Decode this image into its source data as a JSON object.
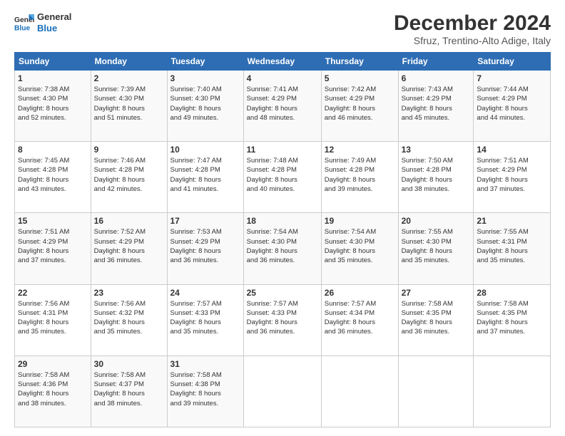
{
  "logo": {
    "line1": "General",
    "line2": "Blue"
  },
  "title": "December 2024",
  "subtitle": "Sfruz, Trentino-Alto Adige, Italy",
  "days_of_week": [
    "Sunday",
    "Monday",
    "Tuesday",
    "Wednesday",
    "Thursday",
    "Friday",
    "Saturday"
  ],
  "weeks": [
    [
      {
        "day": "1",
        "info": "Sunrise: 7:38 AM\nSunset: 4:30 PM\nDaylight: 8 hours\nand 52 minutes."
      },
      {
        "day": "2",
        "info": "Sunrise: 7:39 AM\nSunset: 4:30 PM\nDaylight: 8 hours\nand 51 minutes."
      },
      {
        "day": "3",
        "info": "Sunrise: 7:40 AM\nSunset: 4:30 PM\nDaylight: 8 hours\nand 49 minutes."
      },
      {
        "day": "4",
        "info": "Sunrise: 7:41 AM\nSunset: 4:29 PM\nDaylight: 8 hours\nand 48 minutes."
      },
      {
        "day": "5",
        "info": "Sunrise: 7:42 AM\nSunset: 4:29 PM\nDaylight: 8 hours\nand 46 minutes."
      },
      {
        "day": "6",
        "info": "Sunrise: 7:43 AM\nSunset: 4:29 PM\nDaylight: 8 hours\nand 45 minutes."
      },
      {
        "day": "7",
        "info": "Sunrise: 7:44 AM\nSunset: 4:29 PM\nDaylight: 8 hours\nand 44 minutes."
      }
    ],
    [
      {
        "day": "8",
        "info": "Sunrise: 7:45 AM\nSunset: 4:28 PM\nDaylight: 8 hours\nand 43 minutes."
      },
      {
        "day": "9",
        "info": "Sunrise: 7:46 AM\nSunset: 4:28 PM\nDaylight: 8 hours\nand 42 minutes."
      },
      {
        "day": "10",
        "info": "Sunrise: 7:47 AM\nSunset: 4:28 PM\nDaylight: 8 hours\nand 41 minutes."
      },
      {
        "day": "11",
        "info": "Sunrise: 7:48 AM\nSunset: 4:28 PM\nDaylight: 8 hours\nand 40 minutes."
      },
      {
        "day": "12",
        "info": "Sunrise: 7:49 AM\nSunset: 4:28 PM\nDaylight: 8 hours\nand 39 minutes."
      },
      {
        "day": "13",
        "info": "Sunrise: 7:50 AM\nSunset: 4:28 PM\nDaylight: 8 hours\nand 38 minutes."
      },
      {
        "day": "14",
        "info": "Sunrise: 7:51 AM\nSunset: 4:29 PM\nDaylight: 8 hours\nand 37 minutes."
      }
    ],
    [
      {
        "day": "15",
        "info": "Sunrise: 7:51 AM\nSunset: 4:29 PM\nDaylight: 8 hours\nand 37 minutes."
      },
      {
        "day": "16",
        "info": "Sunrise: 7:52 AM\nSunset: 4:29 PM\nDaylight: 8 hours\nand 36 minutes."
      },
      {
        "day": "17",
        "info": "Sunrise: 7:53 AM\nSunset: 4:29 PM\nDaylight: 8 hours\nand 36 minutes."
      },
      {
        "day": "18",
        "info": "Sunrise: 7:54 AM\nSunset: 4:30 PM\nDaylight: 8 hours\nand 36 minutes."
      },
      {
        "day": "19",
        "info": "Sunrise: 7:54 AM\nSunset: 4:30 PM\nDaylight: 8 hours\nand 35 minutes."
      },
      {
        "day": "20",
        "info": "Sunrise: 7:55 AM\nSunset: 4:30 PM\nDaylight: 8 hours\nand 35 minutes."
      },
      {
        "day": "21",
        "info": "Sunrise: 7:55 AM\nSunset: 4:31 PM\nDaylight: 8 hours\nand 35 minutes."
      }
    ],
    [
      {
        "day": "22",
        "info": "Sunrise: 7:56 AM\nSunset: 4:31 PM\nDaylight: 8 hours\nand 35 minutes."
      },
      {
        "day": "23",
        "info": "Sunrise: 7:56 AM\nSunset: 4:32 PM\nDaylight: 8 hours\nand 35 minutes."
      },
      {
        "day": "24",
        "info": "Sunrise: 7:57 AM\nSunset: 4:33 PM\nDaylight: 8 hours\nand 35 minutes."
      },
      {
        "day": "25",
        "info": "Sunrise: 7:57 AM\nSunset: 4:33 PM\nDaylight: 8 hours\nand 36 minutes."
      },
      {
        "day": "26",
        "info": "Sunrise: 7:57 AM\nSunset: 4:34 PM\nDaylight: 8 hours\nand 36 minutes."
      },
      {
        "day": "27",
        "info": "Sunrise: 7:58 AM\nSunset: 4:35 PM\nDaylight: 8 hours\nand 36 minutes."
      },
      {
        "day": "28",
        "info": "Sunrise: 7:58 AM\nSunset: 4:35 PM\nDaylight: 8 hours\nand 37 minutes."
      }
    ],
    [
      {
        "day": "29",
        "info": "Sunrise: 7:58 AM\nSunset: 4:36 PM\nDaylight: 8 hours\nand 38 minutes."
      },
      {
        "day": "30",
        "info": "Sunrise: 7:58 AM\nSunset: 4:37 PM\nDaylight: 8 hours\nand 38 minutes."
      },
      {
        "day": "31",
        "info": "Sunrise: 7:58 AM\nSunset: 4:38 PM\nDaylight: 8 hours\nand 39 minutes."
      },
      {
        "day": "",
        "info": ""
      },
      {
        "day": "",
        "info": ""
      },
      {
        "day": "",
        "info": ""
      },
      {
        "day": "",
        "info": ""
      }
    ]
  ]
}
